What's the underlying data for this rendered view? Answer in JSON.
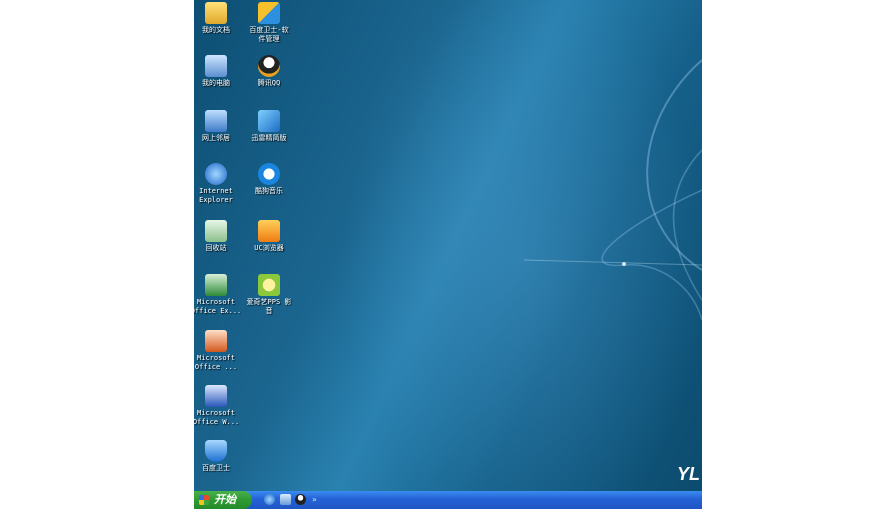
{
  "desktop": {
    "icons": [
      {
        "label": "我的文档"
      },
      {
        "label": "百度卫士-软\n件管理"
      },
      {
        "label": "我的电脑"
      },
      {
        "label": "腾讯QQ"
      },
      {
        "label": "网上邻居"
      },
      {
        "label": "迅雷精简版"
      },
      {
        "label": "Internet\nExplorer"
      },
      {
        "label": "酷狗音乐"
      },
      {
        "label": "回收站"
      },
      {
        "label": "UC浏览器"
      },
      {
        "label": "Microsoft\nOffice Ex..."
      },
      {
        "label": "爱奇艺PPS 影\n音"
      },
      {
        "label": "Microsoft\nOffice ..."
      },
      {
        "label": "Microsoft\nOffice W..."
      },
      {
        "label": "百度卫士"
      }
    ],
    "wallpaper_logo": "YL"
  },
  "taskbar": {
    "start_label": "开始",
    "quick_launch": [
      "internet-explorer-icon",
      "show-desktop-icon",
      "qq-icon"
    ]
  }
}
